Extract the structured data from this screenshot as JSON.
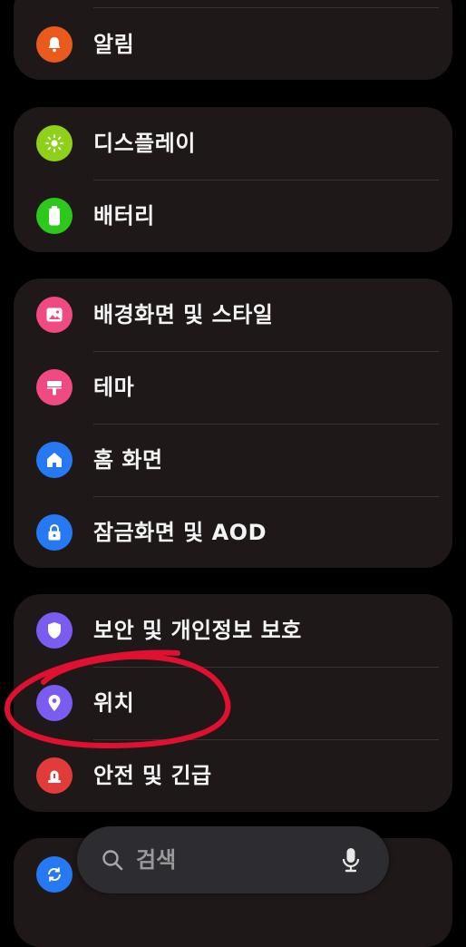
{
  "colors": {
    "background": "#000000",
    "card": "#1e1918",
    "divider": "#3a3433",
    "annotation": "#e01030"
  },
  "groups": [
    {
      "items": [
        {
          "label": "알림",
          "icon": "bell-icon",
          "color": "#ea5a1c"
        }
      ]
    },
    {
      "items": [
        {
          "label": "디스플레이",
          "icon": "sun-icon",
          "color": "#8fd01a"
        },
        {
          "label": "배터리",
          "icon": "battery-icon",
          "color": "#2ec71c"
        }
      ]
    },
    {
      "items": [
        {
          "label": "배경화면 및 스타일",
          "icon": "image-icon",
          "color": "#ef4a82"
        },
        {
          "label": "테마",
          "icon": "paint-roller-icon",
          "color": "#ef4a82"
        },
        {
          "label": "홈 화면",
          "icon": "home-icon",
          "color": "#2679f2"
        },
        {
          "label": "잠금화면 및 AOD",
          "icon": "lock-icon",
          "color": "#2679f2"
        }
      ]
    },
    {
      "items": [
        {
          "label": "보안 및 개인정보 보호",
          "icon": "shield-icon",
          "color": "#7c5cf0"
        },
        {
          "label": "위치",
          "icon": "location-pin-icon",
          "color": "#7c5cf0"
        },
        {
          "label": "안전 및 긴급",
          "icon": "emergency-siren-icon",
          "color": "#e23b3b"
        }
      ]
    },
    {
      "items": [
        {
          "label": "",
          "icon": "sync-icon",
          "color": "#2679f2"
        }
      ]
    }
  ],
  "search": {
    "placeholder": "검색",
    "icon": "search-icon",
    "mic_icon": "microphone-icon"
  }
}
